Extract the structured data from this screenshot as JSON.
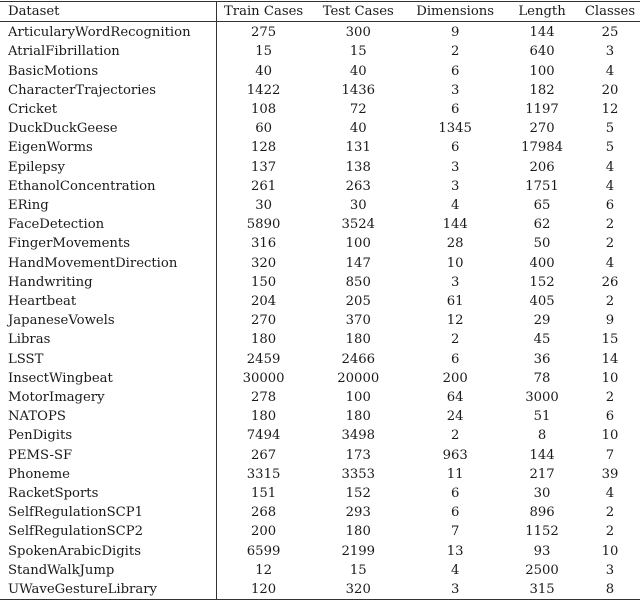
{
  "table": {
    "headers": [
      "Dataset",
      "Train Cases",
      "Test Cases",
      "Dimensions",
      "Length",
      "Classes"
    ],
    "rows": [
      [
        "ArticularyWordRecognition",
        "275",
        "300",
        "9",
        "144",
        "25"
      ],
      [
        "AtrialFibrillation",
        "15",
        "15",
        "2",
        "640",
        "3"
      ],
      [
        "BasicMotions",
        "40",
        "40",
        "6",
        "100",
        "4"
      ],
      [
        "CharacterTrajectories",
        "1422",
        "1436",
        "3",
        "182",
        "20"
      ],
      [
        "Cricket",
        "108",
        "72",
        "6",
        "1197",
        "12"
      ],
      [
        "DuckDuckGeese",
        "60",
        "40",
        "1345",
        "270",
        "5"
      ],
      [
        "EigenWorms",
        "128",
        "131",
        "6",
        "17984",
        "5"
      ],
      [
        "Epilepsy",
        "137",
        "138",
        "3",
        "206",
        "4"
      ],
      [
        "EthanolConcentration",
        "261",
        "263",
        "3",
        "1751",
        "4"
      ],
      [
        "ERing",
        "30",
        "30",
        "4",
        "65",
        "6"
      ],
      [
        "FaceDetection",
        "5890",
        "3524",
        "144",
        "62",
        "2"
      ],
      [
        "FingerMovements",
        "316",
        "100",
        "28",
        "50",
        "2"
      ],
      [
        "HandMovementDirection",
        "320",
        "147",
        "10",
        "400",
        "4"
      ],
      [
        "Handwriting",
        "150",
        "850",
        "3",
        "152",
        "26"
      ],
      [
        "Heartbeat",
        "204",
        "205",
        "61",
        "405",
        "2"
      ],
      [
        "JapaneseVowels",
        "270",
        "370",
        "12",
        "29",
        "9"
      ],
      [
        "Libras",
        "180",
        "180",
        "2",
        "45",
        "15"
      ],
      [
        "LSST",
        "2459",
        "2466",
        "6",
        "36",
        "14"
      ],
      [
        "InsectWingbeat",
        "30000",
        "20000",
        "200",
        "78",
        "10"
      ],
      [
        "MotorImagery",
        "278",
        "100",
        "64",
        "3000",
        "2"
      ],
      [
        "NATOPS",
        "180",
        "180",
        "24",
        "51",
        "6"
      ],
      [
        "PenDigits",
        "7494",
        "3498",
        "2",
        "8",
        "10"
      ],
      [
        "PEMS-SF",
        "267",
        "173",
        "963",
        "144",
        "7"
      ],
      [
        "Phoneme",
        "3315",
        "3353",
        "11",
        "217",
        "39"
      ],
      [
        "RacketSports",
        "151",
        "152",
        "6",
        "30",
        "4"
      ],
      [
        "SelfRegulationSCP1",
        "268",
        "293",
        "6",
        "896",
        "2"
      ],
      [
        "SelfRegulationSCP2",
        "200",
        "180",
        "7",
        "1152",
        "2"
      ],
      [
        "SpokenArabicDigits",
        "6599",
        "2199",
        "13",
        "93",
        "10"
      ],
      [
        "StandWalkJump",
        "12",
        "15",
        "4",
        "2500",
        "3"
      ],
      [
        "UWaveGestureLibrary",
        "120",
        "320",
        "3",
        "315",
        "8"
      ]
    ]
  }
}
